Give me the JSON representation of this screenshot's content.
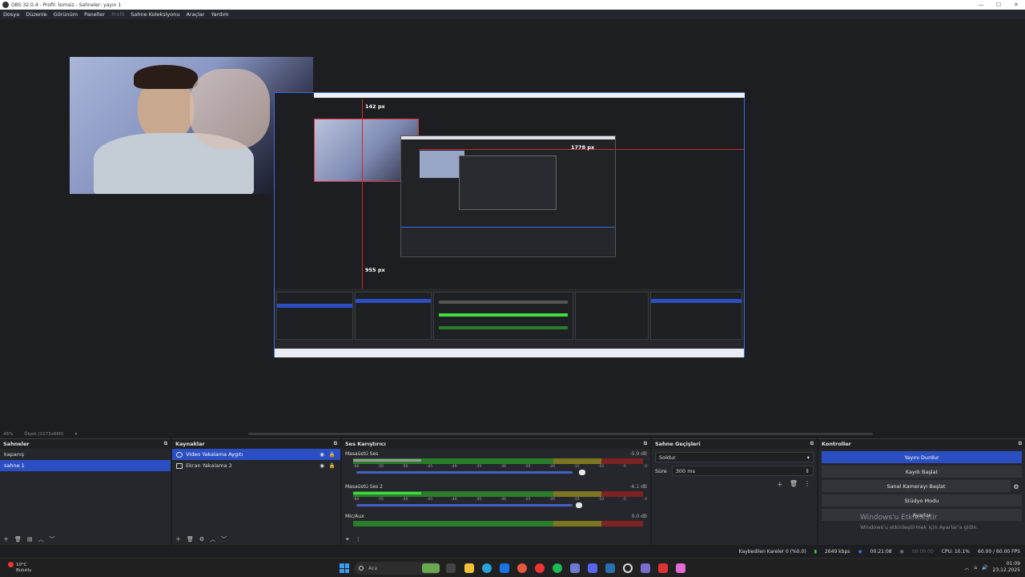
{
  "window": {
    "title": "OBS 32.0.4 - Profil: İsimsiz - Sahneler: yayın 1",
    "minimize": "—",
    "maximize": "☐",
    "close": "✕"
  },
  "menu": [
    "Dosya",
    "Düzenle",
    "Görünüm",
    "Paneller",
    "Profil",
    "Sahne Koleksiyonu",
    "Araçlar",
    "Yardım"
  ],
  "menu_disabled": [
    "Profil"
  ],
  "preview": {
    "label_top": "142 px",
    "label_right": "1778 px",
    "label_bottom": "955 px"
  },
  "statusline": {
    "zoom": "45%",
    "scale": "Ölçek (1173x660)"
  },
  "scenes": {
    "title": "Sahneler",
    "items": [
      "kapanış",
      "sahne 1"
    ],
    "selected": 1
  },
  "sources": {
    "title": "Kaynaklar",
    "items": [
      {
        "label": "Video Yakalama Aygıtı",
        "icon": "camera-icon",
        "selected": true
      },
      {
        "label": "Ekran Yakalama 2",
        "icon": "monitor-icon",
        "selected": false
      }
    ]
  },
  "mixer": {
    "title": "Ses Karıştırıcı",
    "channels": [
      {
        "name": "Masaüstü Ses",
        "db": "-5.9 dB",
        "level": 0.06
      },
      {
        "name": "Masaüstü Ses 2",
        "db": "-6.1 dB",
        "level": 0.27
      },
      {
        "name": "Mic/Aux",
        "db": "0.0 dB",
        "level": 0.0
      }
    ],
    "ticks": [
      "-60",
      "-55",
      "-50",
      "-45",
      "-40",
      "-35",
      "-30",
      "-25",
      "-20",
      "-15",
      "-10",
      "-5",
      "0"
    ]
  },
  "transitions": {
    "title": "Sahne Geçişleri",
    "selected": "Soldur",
    "duration_label": "Süre",
    "duration": "300 ms"
  },
  "controls": {
    "title": "Kontroller",
    "buttons": [
      "Yayını Durdur",
      "Kaydı Başlat",
      "Sanal Kamerayı Başlat",
      "Stüdyo Modu",
      "Ayarlar"
    ]
  },
  "watermark": {
    "title": "Windows'u Etkinleştir",
    "sub": "Windows'u etkinleştirmek için Ayarlar'a gidin."
  },
  "obs_status": {
    "dropped": "Kaybedilen Kareler 0 (%0.0)",
    "bitrate": "2649 kbps",
    "live_time": "00:21:08",
    "rec_time": "00:00:00",
    "cpu": "CPU: 10.1%",
    "fps": "60.00 / 60.00 FPS"
  },
  "taskbar": {
    "weather_temp": "10°C",
    "weather_desc": "Bulutlu",
    "search": "Ara",
    "time": "01:09",
    "date": "23.12.2025"
  },
  "colors": {
    "accent": "#2b4fc2",
    "guide_red": "#d02828",
    "meter_green": "#3fdc3f"
  }
}
